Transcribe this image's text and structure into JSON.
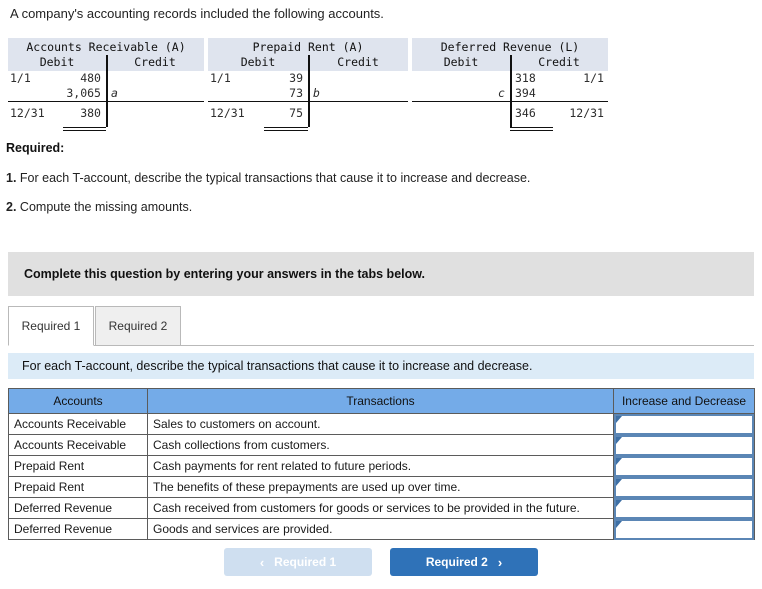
{
  "intro": "A company's accounting records included the following accounts.",
  "t_accounts": [
    {
      "title": "Accounts Receivable (A)",
      "debit_header": "Debit",
      "credit_header": "Credit",
      "rows": [
        {
          "debit_label": "1/1",
          "debit_amount": "480",
          "credit_label": "",
          "credit_amount": ""
        },
        {
          "debit_label": "",
          "debit_amount": "3,065",
          "credit_label": "a",
          "credit_amount": "",
          "credit_italic": true
        }
      ],
      "balance": {
        "debit_label": "12/31",
        "debit_amount": "380",
        "credit_label": "",
        "credit_amount": ""
      },
      "balance_side": "debit"
    },
    {
      "title": "Prepaid Rent (A)",
      "debit_header": "Debit",
      "credit_header": "Credit",
      "rows": [
        {
          "debit_label": "1/1",
          "debit_amount": "39",
          "credit_label": "",
          "credit_amount": ""
        },
        {
          "debit_label": "",
          "debit_amount": "73",
          "credit_label": "b",
          "credit_amount": "",
          "credit_italic": true
        }
      ],
      "balance": {
        "debit_label": "12/31",
        "debit_amount": "75",
        "credit_label": "",
        "credit_amount": ""
      },
      "balance_side": "debit"
    },
    {
      "title": "Deferred Revenue (L)",
      "debit_header": "Debit",
      "credit_header": "Credit",
      "rows": [
        {
          "debit_label": "",
          "debit_amount": "",
          "credit_label": "318",
          "credit_amount": "1/1"
        },
        {
          "debit_label": "",
          "debit_amount": "c",
          "debit_italic": true,
          "credit_label": "394",
          "credit_amount": ""
        }
      ],
      "balance": {
        "debit_label": "",
        "debit_amount": "",
        "credit_label": "346",
        "credit_amount": "12/31"
      },
      "balance_side": "credit"
    }
  ],
  "required": {
    "heading": "Required:",
    "items": [
      {
        "num": "1.",
        "text": "For each T-account, describe the typical transactions that cause it to increase and decrease."
      },
      {
        "num": "2.",
        "text": "Compute the missing amounts."
      }
    ]
  },
  "callout": "Complete this question by entering your answers in the tabs below.",
  "tabs": [
    {
      "label": "Required 1",
      "active": true
    },
    {
      "label": "Required 2",
      "active": false
    }
  ],
  "instruction": "For each T-account, describe the typical transactions that cause it to increase and decrease.",
  "answer_table": {
    "headers": [
      "Accounts",
      "Transactions",
      "Increase and Decrease"
    ],
    "rows": [
      {
        "account": "Accounts Receivable",
        "transaction": "Sales to customers on account.",
        "answer": ""
      },
      {
        "account": "Accounts Receivable",
        "transaction": "Cash collections from customers.",
        "answer": ""
      },
      {
        "account": "Prepaid Rent",
        "transaction": "Cash payments for rent related to future periods.",
        "answer": ""
      },
      {
        "account": "Prepaid Rent",
        "transaction": "The benefits of these prepayments are used up over time.",
        "answer": ""
      },
      {
        "account": "Deferred Revenue",
        "transaction": "Cash received from customers for goods or services to be provided in the future.",
        "answer": ""
      },
      {
        "account": "Deferred Revenue",
        "transaction": "Goods and services are provided.",
        "answer": ""
      }
    ]
  },
  "nav": {
    "prev_label": "Required 1",
    "next_label": "Required 2",
    "prev_chevron": "‹",
    "next_chevron": "›"
  },
  "colors": {
    "table_header_blue": "#74abe8",
    "instruction_blue": "#dcebf7",
    "callout_grey": "#e0e0e0",
    "taccount_header": "#dfe4ee",
    "next_button_blue": "#2f72b8",
    "prev_button_blue": "#cfdff0",
    "select_border": "#5b86b5"
  }
}
